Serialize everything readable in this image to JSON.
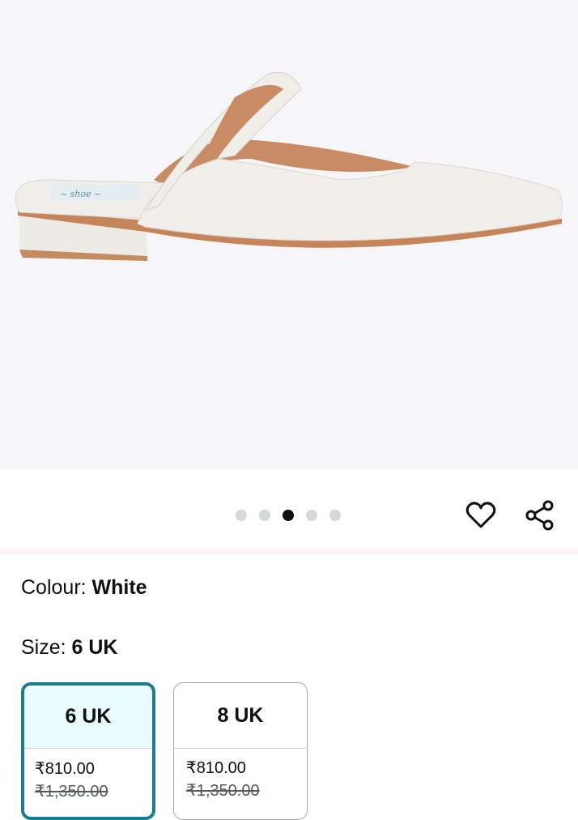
{
  "product_image": {
    "label": "White pointed-toe mule with ankle strap",
    "brand_mark": "shoe-insole-logo"
  },
  "carousel": {
    "count": 5,
    "active_index": 2
  },
  "actions": {
    "wishlist_icon": "heart-icon",
    "share_icon": "share-icon"
  },
  "colour": {
    "label": "Colour: ",
    "value": "White"
  },
  "size": {
    "label": "Size: ",
    "value": "6 UK",
    "options": [
      {
        "size": "6 UK",
        "price": "₹810.00",
        "mrp": "₹1,350.00",
        "selected": true
      },
      {
        "size": "8 UK",
        "price": "₹810.00",
        "mrp": "₹1,350.00",
        "selected": false
      }
    ]
  },
  "colors": {
    "accent": "#187d8e",
    "selected_bg": "#e9fbff",
    "gallery_bg": "#f6f6f8"
  }
}
